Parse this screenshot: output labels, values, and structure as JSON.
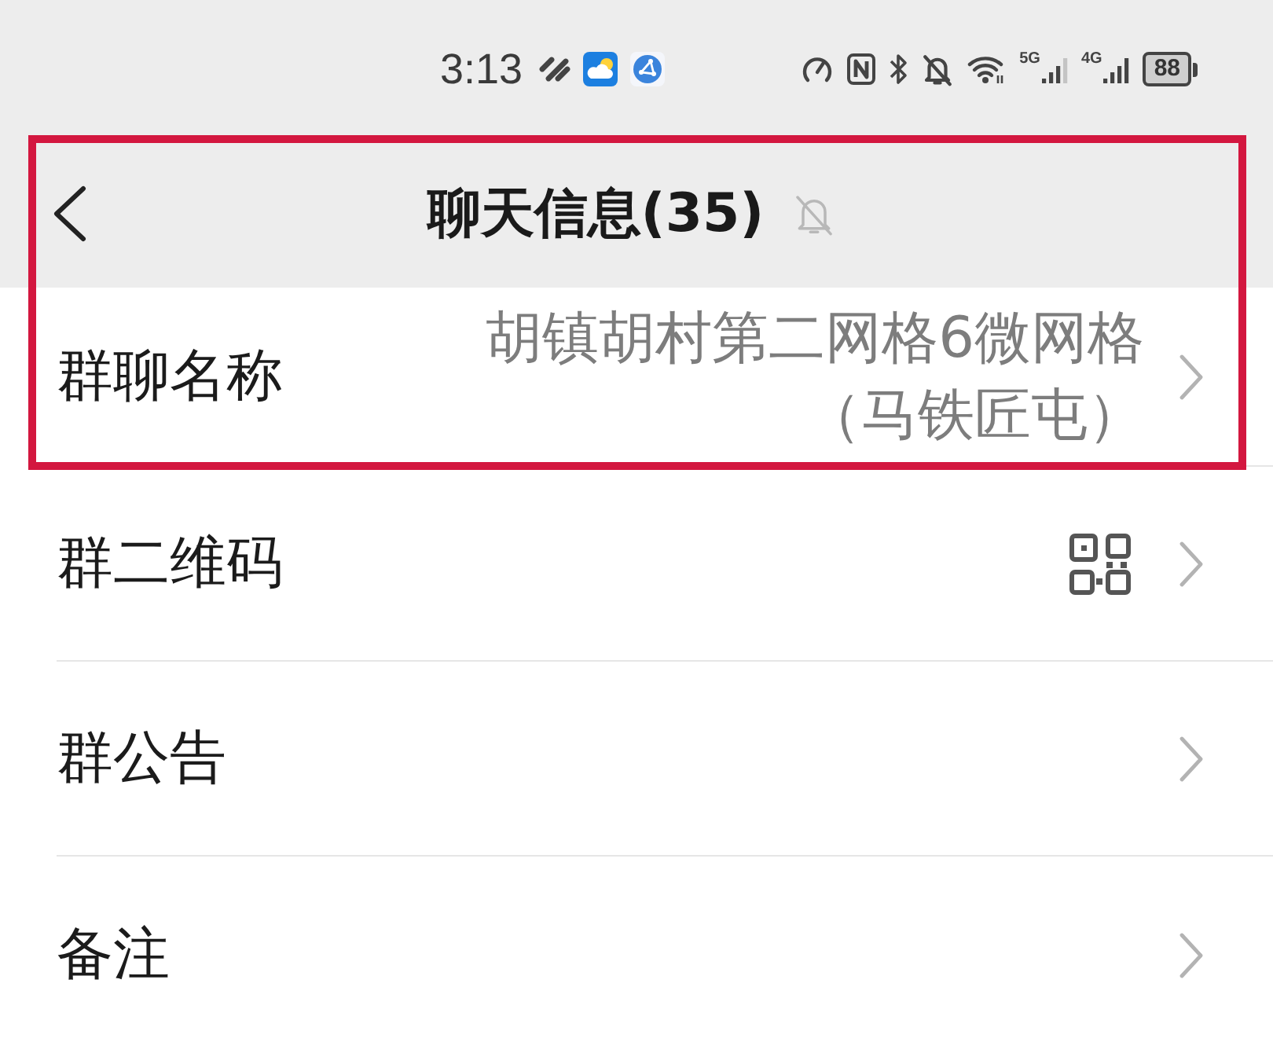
{
  "status_bar": {
    "time": "3:13",
    "network_labels": [
      "5G",
      "4G"
    ],
    "battery": "88"
  },
  "title_bar": {
    "title": "聊天信息(35)",
    "muted": true
  },
  "rows": [
    {
      "kind": "value",
      "label": "群聊名称",
      "value": "胡镇胡村第二网格6微网格（马铁匠屯）"
    },
    {
      "kind": "qr",
      "label": "群二维码"
    },
    {
      "kind": "plain",
      "label": "群公告"
    },
    {
      "kind": "plain",
      "label": "备注"
    }
  ],
  "highlight_frame": true
}
